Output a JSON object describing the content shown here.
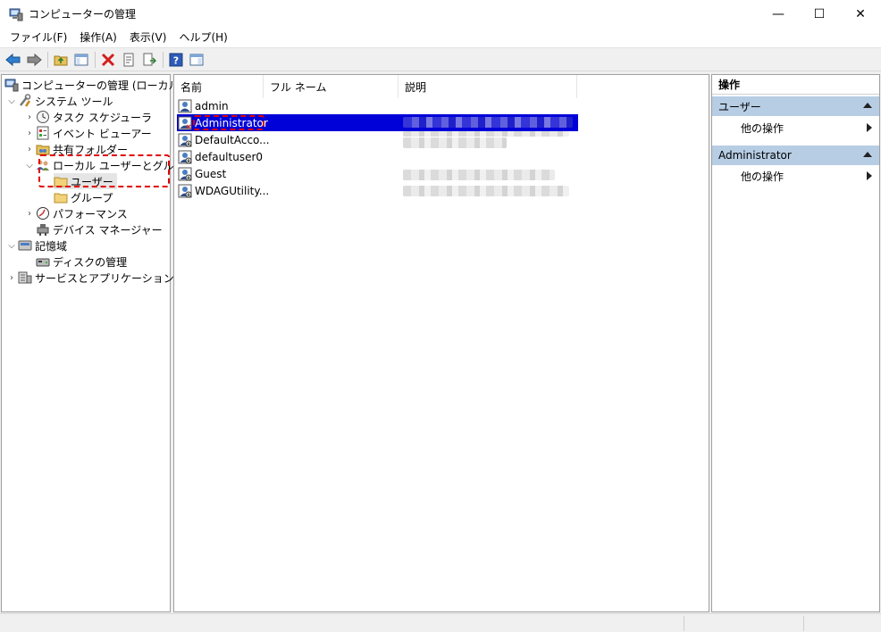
{
  "window": {
    "title": "コンピューターの管理",
    "controls": {
      "minimize": "—",
      "maximize": "☐",
      "close": "✕"
    }
  },
  "menu": [
    "ファイル(F)",
    "操作(A)",
    "表示(V)",
    "ヘルプ(H)"
  ],
  "toolbar": [
    "back-icon",
    "forward-icon",
    "up-folder-icon",
    "show-hide-tree-icon",
    "delete-icon",
    "properties-icon",
    "export-list-icon",
    "help-icon",
    "show-hide-action-pane-icon"
  ],
  "tree": {
    "root": "コンピューターの管理 (ローカル)",
    "system_tools": "システム ツール",
    "task_scheduler": "タスク スケジューラ",
    "event_viewer": "イベント ビューアー",
    "shared_folders": "共有フォルダー",
    "local_users_groups": "ローカル ユーザーとグループ",
    "users": "ユーザー",
    "groups": "グループ",
    "performance": "パフォーマンス",
    "device_manager": "デバイス マネージャー",
    "storage": "記憶域",
    "disk_management": "ディスクの管理",
    "services_apps": "サービスとアプリケーション"
  },
  "list": {
    "columns": [
      "名前",
      "フル ネーム",
      "説明"
    ],
    "rows": [
      "admin",
      "Administrator",
      "DefaultAcco...",
      "defaultuser0",
      "Guest",
      "WDAGUtility..."
    ],
    "selected_index": 1
  },
  "actions": {
    "header": "操作",
    "sections": [
      {
        "title": "ユーザー",
        "link": "他の操作"
      },
      {
        "title": "Administrator",
        "link": "他の操作"
      }
    ]
  },
  "colors": {
    "selection": "#0000d8",
    "section_bg": "#b6cde4",
    "highlight": "#e00000"
  }
}
